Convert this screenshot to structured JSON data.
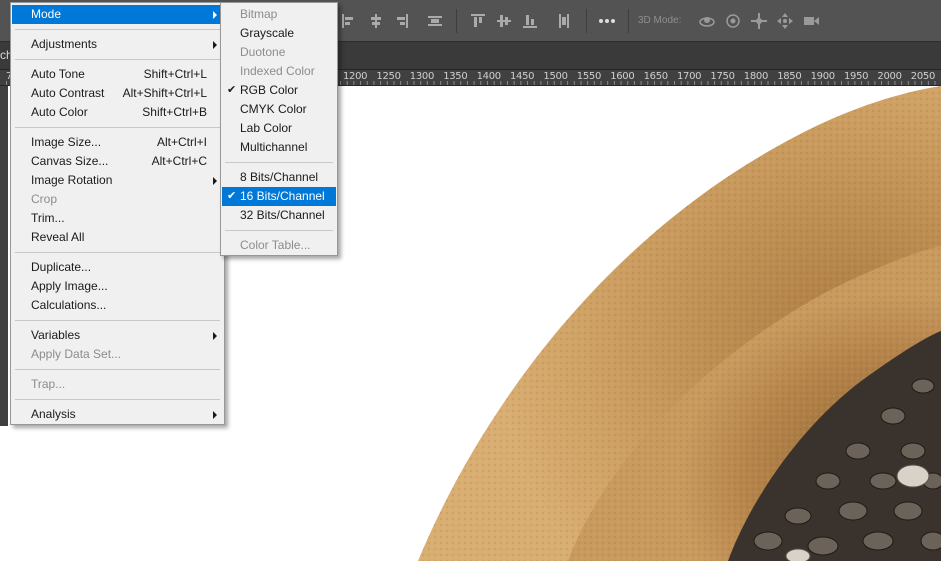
{
  "toolbar": {
    "mode_3d_label": "3D Mode:",
    "icons": [
      "align-left-icon",
      "align-hcenter-icon",
      "align-right-icon",
      "distribute-icon",
      "align-top-icon",
      "align-vcenter-icon",
      "align-bottom-icon",
      "distribute-v-icon",
      "more-icon",
      "orbit-3d-icon",
      "roll-3d-icon",
      "pan-3d-icon",
      "slide-3d-icon",
      "scale-3d-icon"
    ]
  },
  "document_tab": {
    "label_fragment": "ch"
  },
  "ruler": {
    "labels": [
      "1200",
      "1250",
      "1300",
      "1350",
      "1400",
      "1450",
      "1500",
      "1550",
      "1600",
      "1650",
      "1700",
      "1750",
      "1800",
      "1850",
      "1900",
      "1950",
      "2000",
      "2050"
    ],
    "hidden_left_label": "7"
  },
  "image_menu": {
    "items": [
      {
        "label": "Mode",
        "shortcut": "",
        "submenu": true,
        "enabled": true,
        "highlighted": true
      },
      {
        "separator": true
      },
      {
        "label": "Adjustments",
        "shortcut": "",
        "submenu": true,
        "enabled": true
      },
      {
        "separator": true
      },
      {
        "label": "Auto Tone",
        "shortcut": "Shift+Ctrl+L",
        "enabled": true
      },
      {
        "label": "Auto Contrast",
        "shortcut": "Alt+Shift+Ctrl+L",
        "enabled": true
      },
      {
        "label": "Auto Color",
        "shortcut": "Shift+Ctrl+B",
        "enabled": true
      },
      {
        "separator": true
      },
      {
        "label": "Image Size...",
        "shortcut": "Alt+Ctrl+I",
        "enabled": true
      },
      {
        "label": "Canvas Size...",
        "shortcut": "Alt+Ctrl+C",
        "enabled": true
      },
      {
        "label": "Image Rotation",
        "shortcut": "",
        "submenu": true,
        "enabled": true
      },
      {
        "label": "Crop",
        "shortcut": "",
        "enabled": false
      },
      {
        "label": "Trim...",
        "shortcut": "",
        "enabled": true
      },
      {
        "label": "Reveal All",
        "shortcut": "",
        "enabled": true
      },
      {
        "separator": true
      },
      {
        "label": "Duplicate...",
        "shortcut": "",
        "enabled": true
      },
      {
        "label": "Apply Image...",
        "shortcut": "",
        "enabled": true
      },
      {
        "label": "Calculations...",
        "shortcut": "",
        "enabled": true
      },
      {
        "separator": true
      },
      {
        "label": "Variables",
        "shortcut": "",
        "submenu": true,
        "enabled": true
      },
      {
        "label": "Apply Data Set...",
        "shortcut": "",
        "enabled": false
      },
      {
        "separator": true
      },
      {
        "label": "Trap...",
        "shortcut": "",
        "enabled": false
      },
      {
        "separator": true
      },
      {
        "label": "Analysis",
        "shortcut": "",
        "submenu": true,
        "enabled": true
      }
    ]
  },
  "mode_submenu": {
    "items": [
      {
        "label": "Bitmap",
        "enabled": false
      },
      {
        "label": "Grayscale",
        "enabled": true
      },
      {
        "label": "Duotone",
        "enabled": false
      },
      {
        "label": "Indexed Color",
        "enabled": false
      },
      {
        "label": "RGB Color",
        "enabled": true,
        "checked": true
      },
      {
        "label": "CMYK Color",
        "enabled": true
      },
      {
        "label": "Lab Color",
        "enabled": true
      },
      {
        "label": "Multichannel",
        "enabled": true
      },
      {
        "separator": true
      },
      {
        "label": "8 Bits/Channel",
        "enabled": true
      },
      {
        "label": "16 Bits/Channel",
        "enabled": true,
        "checked": true,
        "highlighted": true
      },
      {
        "label": "32 Bits/Channel",
        "enabled": true
      },
      {
        "separator": true
      },
      {
        "label": "Color Table...",
        "enabled": false
      }
    ]
  },
  "colors": {
    "highlight": "#0078d7",
    "menu_bg": "#f0f0f0",
    "disabled_text": "#8c8c8c",
    "chrome_bg": "#535353",
    "bowl": "#c49a5c"
  },
  "checkmark_glyph": "✔"
}
